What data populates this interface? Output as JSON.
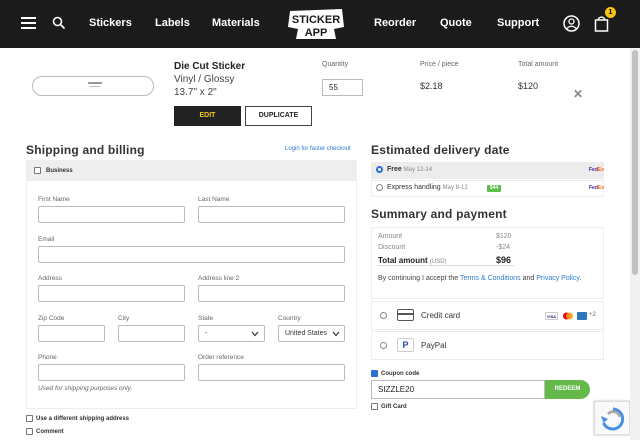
{
  "nav": {
    "items": [
      "Stickers",
      "Labels",
      "Materials",
      "Reorder",
      "Quote",
      "Support"
    ],
    "logo_line1": "STICKER",
    "logo_line2": "APP",
    "cart_count": "1"
  },
  "product": {
    "title": "Die Cut Sticker",
    "material": "Vinyl / Glossy",
    "size": "13.7\" x 2\"",
    "quantity_label": "Quantity",
    "quantity_value": "55",
    "price_label": "Price / piece",
    "price_value": "$2.18",
    "total_label": "Total amount",
    "total_value": "$120",
    "edit_label": "EDIT",
    "duplicate_label": "DUPLICATE"
  },
  "shipping": {
    "title": "Shipping and billing",
    "login_link": "Login for faster checkout",
    "business_label": "Business",
    "fields": {
      "first_name": "First Name",
      "last_name": "Last Name",
      "email": "Email",
      "address": "Address",
      "address2": "Address line 2",
      "zip": "Zip Code",
      "city": "City",
      "state": "State",
      "state_value": "-",
      "country": "Country",
      "country_value": "United States",
      "phone": "Phone",
      "order_ref": "Order reference"
    },
    "hint": "Used for shipping purposes only.",
    "different_address": "Use a different shipping address",
    "comment": "Comment"
  },
  "delivery": {
    "title": "Estimated delivery date",
    "options": [
      {
        "label": "Free",
        "date": "May 12-14",
        "carrier_fe": "Fed",
        "carrier_ex": "Ex"
      },
      {
        "label": "Express handling",
        "date": "May 8-12",
        "badge": "$44",
        "carrier_fe": "Fed",
        "carrier_ex": "Ex"
      }
    ]
  },
  "summary": {
    "title": "Summary and payment",
    "amount_label": "Amount",
    "amount_value": "$120",
    "discount_label": "Discount",
    "discount_value": "-$24",
    "total_label": "Total amount",
    "total_unit": "(USD)",
    "total_value": "$96",
    "terms_prefix": "By continuing I accept the ",
    "terms_link": "Terms & Conditions",
    "terms_and": " and ",
    "privacy_link": "Privacy Policy",
    "terms_suffix": "."
  },
  "payment": {
    "credit_card_label": "Credit card",
    "paypal_label": "PayPal",
    "visa_label": "VISA",
    "more_cards": "+2"
  },
  "coupon": {
    "label": "Coupon code",
    "value": "SIZZLE20",
    "redeem_label": "REDEEM",
    "gift_card_label": "Gift Card"
  }
}
